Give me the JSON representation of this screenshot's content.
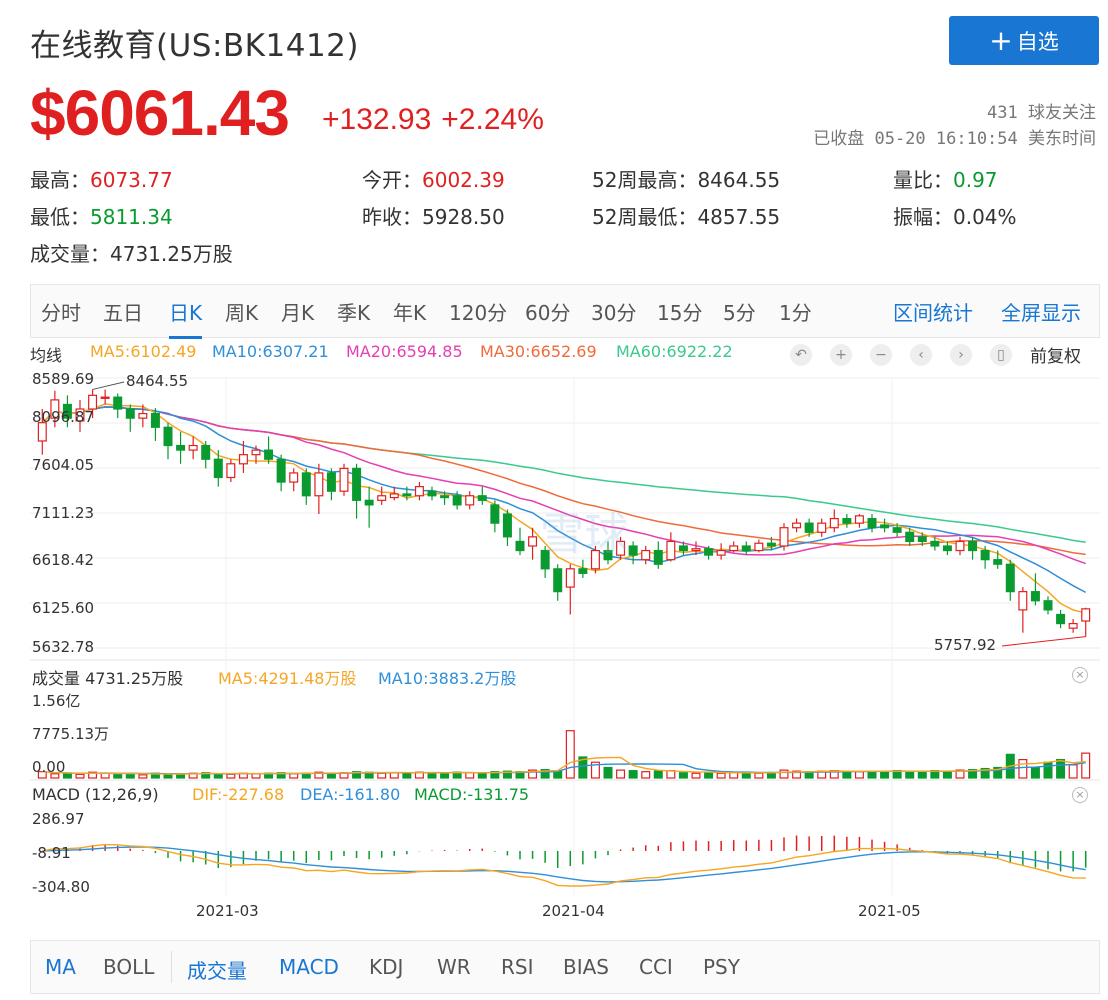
{
  "header": {
    "title": "在线教育(US:BK1412)",
    "follow_label": "自选",
    "price": "$6061.43",
    "change": "+132.93",
    "change_pct": "+2.24%",
    "followers": "431 球友关注",
    "status": "已收盘 05-20 16:10:54 美东时间"
  },
  "stats": {
    "high_label": "最高：",
    "high": "6073.77",
    "open_label": "今开：",
    "open": "6002.39",
    "w52_high_label": "52周最高：",
    "w52_high": "8464.55",
    "vol_ratio_label": "量比：",
    "vol_ratio": "0.97",
    "low_label": "最低：",
    "low": "5811.34",
    "prev_close_label": "昨收：",
    "prev_close": "5928.50",
    "w52_low_label": "52周最低：",
    "w52_low": "4857.55",
    "amplitude_label": "振幅：",
    "amplitude": "0.04%",
    "volume_label": "成交量：",
    "volume": "4731.25万股"
  },
  "period_tabs": [
    "分时",
    "五日",
    "日K",
    "周K",
    "月K",
    "季K",
    "年K",
    "120分",
    "60分",
    "30分",
    "15分",
    "5分",
    "1分"
  ],
  "active_tab": "日K",
  "range_stats_label": "区间统计",
  "fullscreen_label": "全屏显示",
  "ma_legend": {
    "title": "均线",
    "ma5": "MA5:6102.49",
    "ma10": "MA10:6307.21",
    "ma20": "MA20:6594.85",
    "ma30": "MA30:6652.69",
    "ma60": "MA60:6922.22"
  },
  "adjust_label": "前复权",
  "price_axis": [
    "8589.69",
    "8096.87",
    "7604.05",
    "7111.23",
    "6618.42",
    "6125.60",
    "5632.78"
  ],
  "max_label": "8464.55",
  "min_label": "5757.92",
  "watermark": "雪球",
  "volume_legend": {
    "title": "成交量 4731.25万股",
    "ma5": "MA5:4291.48万股",
    "ma10": "MA10:3883.2万股",
    "axis": [
      "1.56亿",
      "7775.13万",
      "0.00"
    ]
  },
  "macd_legend": {
    "title": "MACD (12,26,9)",
    "dif": "DIF:-227.68",
    "dea": "DEA:-161.80",
    "macd": "MACD:-131.75",
    "axis": [
      "286.97",
      "-8.91",
      "-304.80"
    ]
  },
  "date_axis": [
    "2021-03",
    "2021-04",
    "2021-05"
  ],
  "indicator_tabs": [
    "MA",
    "BOLL",
    "成交量",
    "MACD",
    "KDJ",
    "WR",
    "RSI",
    "BIAS",
    "CCI",
    "PSY"
  ],
  "colors": {
    "up": "#e02020",
    "down": "#0a9b30",
    "accent": "#1976d2",
    "ma5": "#f5a623",
    "ma10": "#2f8fd8",
    "ma20": "#e53fb1",
    "ma30": "#f06a3a",
    "ma60": "#3bc98d"
  },
  "chart_data": {
    "type": "candlestick",
    "candles": [
      {
        "o": 7900,
        "c": 8100,
        "h": 8250,
        "l": 7750
      },
      {
        "o": 8150,
        "c": 8350,
        "h": 8450,
        "l": 8050
      },
      {
        "o": 8300,
        "c": 8150,
        "h": 8400,
        "l": 8050
      },
      {
        "o": 8120,
        "c": 8250,
        "h": 8350,
        "l": 8000
      },
      {
        "o": 8250,
        "c": 8400,
        "h": 8464.55,
        "l": 8150
      },
      {
        "o": 8380,
        "c": 8380,
        "h": 8464,
        "l": 8300
      },
      {
        "o": 8380,
        "c": 8250,
        "h": 8420,
        "l": 8150
      },
      {
        "o": 8250,
        "c": 8150,
        "h": 8300,
        "l": 8000
      },
      {
        "o": 8150,
        "c": 8200,
        "h": 8300,
        "l": 8050
      },
      {
        "o": 8200,
        "c": 8050,
        "h": 8260,
        "l": 7900
      },
      {
        "o": 8050,
        "c": 7850,
        "h": 8100,
        "l": 7700
      },
      {
        "o": 7850,
        "c": 7800,
        "h": 8000,
        "l": 7650
      },
      {
        "o": 7800,
        "c": 7850,
        "h": 7950,
        "l": 7700
      },
      {
        "o": 7850,
        "c": 7700,
        "h": 7900,
        "l": 7600
      },
      {
        "o": 7700,
        "c": 7500,
        "h": 7800,
        "l": 7400
      },
      {
        "o": 7500,
        "c": 7650,
        "h": 7700,
        "l": 7450
      },
      {
        "o": 7650,
        "c": 7750,
        "h": 7900,
        "l": 7550
      },
      {
        "o": 7750,
        "c": 7800,
        "h": 7850,
        "l": 7650
      },
      {
        "o": 7800,
        "c": 7700,
        "h": 7950,
        "l": 7650
      },
      {
        "o": 7700,
        "c": 7450,
        "h": 7750,
        "l": 7350
      },
      {
        "o": 7450,
        "c": 7550,
        "h": 7600,
        "l": 7350
      },
      {
        "o": 7550,
        "c": 7300,
        "h": 7600,
        "l": 7200
      },
      {
        "o": 7300,
        "c": 7550,
        "h": 7650,
        "l": 7100
      },
      {
        "o": 7550,
        "c": 7350,
        "h": 7600,
        "l": 7250
      },
      {
        "o": 7350,
        "c": 7600,
        "h": 7650,
        "l": 7300
      },
      {
        "o": 7600,
        "c": 7250,
        "h": 7650,
        "l": 7050
      },
      {
        "o": 7250,
        "c": 7200,
        "h": 7400,
        "l": 6950
      },
      {
        "o": 7250,
        "c": 7300,
        "h": 7400,
        "l": 7200
      },
      {
        "o": 7280,
        "c": 7320,
        "h": 7400,
        "l": 7250
      },
      {
        "o": 7320,
        "c": 7300,
        "h": 7400,
        "l": 7250
      },
      {
        "o": 7300,
        "c": 7400,
        "h": 7450,
        "l": 7250
      },
      {
        "o": 7350,
        "c": 7300,
        "h": 7400,
        "l": 7250
      },
      {
        "o": 7300,
        "c": 7280,
        "h": 7350,
        "l": 7200
      },
      {
        "o": 7300,
        "c": 7200,
        "h": 7350,
        "l": 7150
      },
      {
        "o": 7200,
        "c": 7300,
        "h": 7350,
        "l": 7150
      },
      {
        "o": 7300,
        "c": 7250,
        "h": 7400,
        "l": 7200
      },
      {
        "o": 7200,
        "c": 7000,
        "h": 7250,
        "l": 6900
      },
      {
        "o": 7100,
        "c": 6850,
        "h": 7150,
        "l": 6750
      },
      {
        "o": 6800,
        "c": 6700,
        "h": 6950,
        "l": 6650
      },
      {
        "o": 6750,
        "c": 6850,
        "h": 6950,
        "l": 6600
      },
      {
        "o": 6700,
        "c": 6500,
        "h": 6750,
        "l": 6400
      },
      {
        "o": 6500,
        "c": 6250,
        "h": 6550,
        "l": 6150
      },
      {
        "o": 6300,
        "c": 6500,
        "h": 6550,
        "l": 6000
      },
      {
        "o": 6500,
        "c": 6450,
        "h": 6600,
        "l": 6400
      },
      {
        "o": 6500,
        "c": 6700,
        "h": 6750,
        "l": 6450
      },
      {
        "o": 6700,
        "c": 6600,
        "h": 6800,
        "l": 6550
      },
      {
        "o": 6650,
        "c": 6800,
        "h": 6850,
        "l": 6600
      },
      {
        "o": 6750,
        "c": 6650,
        "h": 6800,
        "l": 6550
      },
      {
        "o": 6600,
        "c": 6700,
        "h": 6750,
        "l": 6550
      },
      {
        "o": 6700,
        "c": 6550,
        "h": 6800,
        "l": 6500
      },
      {
        "o": 6600,
        "c": 6800,
        "h": 6900,
        "l": 6580
      },
      {
        "o": 6750,
        "c": 6700,
        "h": 6800,
        "l": 6650
      },
      {
        "o": 6700,
        "c": 6720,
        "h": 6800,
        "l": 6650
      },
      {
        "o": 6720,
        "c": 6650,
        "h": 6750,
        "l": 6600
      },
      {
        "o": 6650,
        "c": 6700,
        "h": 6780,
        "l": 6600
      },
      {
        "o": 6700,
        "c": 6750,
        "h": 6800,
        "l": 6680
      },
      {
        "o": 6750,
        "c": 6700,
        "h": 6800,
        "l": 6650
      },
      {
        "o": 6700,
        "c": 6780,
        "h": 6820,
        "l": 6680
      },
      {
        "o": 6780,
        "c": 6750,
        "h": 6850,
        "l": 6700
      },
      {
        "o": 6750,
        "c": 6950,
        "h": 7000,
        "l": 6700
      },
      {
        "o": 6950,
        "c": 7000,
        "h": 7050,
        "l": 6900
      },
      {
        "o": 7000,
        "c": 6900,
        "h": 7050,
        "l": 6850
      },
      {
        "o": 6900,
        "c": 7000,
        "h": 7050,
        "l": 6850
      },
      {
        "o": 6950,
        "c": 7050,
        "h": 7150,
        "l": 6900
      },
      {
        "o": 7050,
        "c": 7000,
        "h": 7100,
        "l": 6950
      },
      {
        "o": 7000,
        "c": 7080,
        "h": 7100,
        "l": 6950
      },
      {
        "o": 7050,
        "c": 6950,
        "h": 7100,
        "l": 6900
      },
      {
        "o": 6980,
        "c": 6950,
        "h": 7050,
        "l": 6900
      },
      {
        "o": 6950,
        "c": 6900,
        "h": 7000,
        "l": 6850
      },
      {
        "o": 6900,
        "c": 6800,
        "h": 6950,
        "l": 6750
      },
      {
        "o": 6850,
        "c": 6800,
        "h": 6900,
        "l": 6750
      },
      {
        "o": 6800,
        "c": 6750,
        "h": 6850,
        "l": 6700
      },
      {
        "o": 6750,
        "c": 6700,
        "h": 6800,
        "l": 6650
      },
      {
        "o": 6700,
        "c": 6800,
        "h": 6850,
        "l": 6650
      },
      {
        "o": 6800,
        "c": 6700,
        "h": 6850,
        "l": 6600
      },
      {
        "o": 6700,
        "c": 6600,
        "h": 6750,
        "l": 6500
      },
      {
        "o": 6600,
        "c": 6550,
        "h": 6700,
        "l": 6500
      },
      {
        "o": 6550,
        "c": 6250,
        "h": 6600,
        "l": 6150
      },
      {
        "o": 6050,
        "c": 6250,
        "h": 6300,
        "l": 5800
      },
      {
        "o": 6250,
        "c": 6150,
        "h": 6450,
        "l": 6100
      },
      {
        "o": 6150,
        "c": 6050,
        "h": 6200,
        "l": 6000
      },
      {
        "o": 6000,
        "c": 5900,
        "h": 6050,
        "l": 5850
      },
      {
        "o": 5850,
        "c": 5900,
        "h": 5950,
        "l": 5800
      },
      {
        "o": 5928.5,
        "c": 6061.43,
        "h": 6073.77,
        "l": 5757.92
      }
    ],
    "volumes_wan": [
      1200,
      800,
      900,
      700,
      1100,
      900,
      700,
      800,
      600,
      900,
      700,
      800,
      900,
      1000,
      800,
      700,
      900,
      800,
      900,
      1000,
      800,
      900,
      1100,
      900,
      1000,
      1200,
      1100,
      900,
      1000,
      900,
      1100,
      1000,
      900,
      1100,
      1000,
      900,
      1200,
      1300,
      1200,
      1500,
      1600,
      1400,
      9000,
      4000,
      3000,
      2000,
      1500,
      1400,
      1200,
      1300,
      1400,
      1000,
      900,
      1000,
      900,
      1100,
      1000,
      900,
      1000,
      1500,
      1300,
      1200,
      1300,
      1400,
      1300,
      1200,
      1300,
      1200,
      1400,
      1300,
      1200,
      1400,
      1300,
      1500,
      1600,
      1800,
      2000,
      4500,
      3500,
      2000,
      3000,
      3500,
      2500,
      4731.25
    ],
    "price_range": [
      5632.78,
      8589.69
    ],
    "volume_range": [
      0,
      15600
    ],
    "macd_range": [
      -304.8,
      286.97
    ]
  }
}
